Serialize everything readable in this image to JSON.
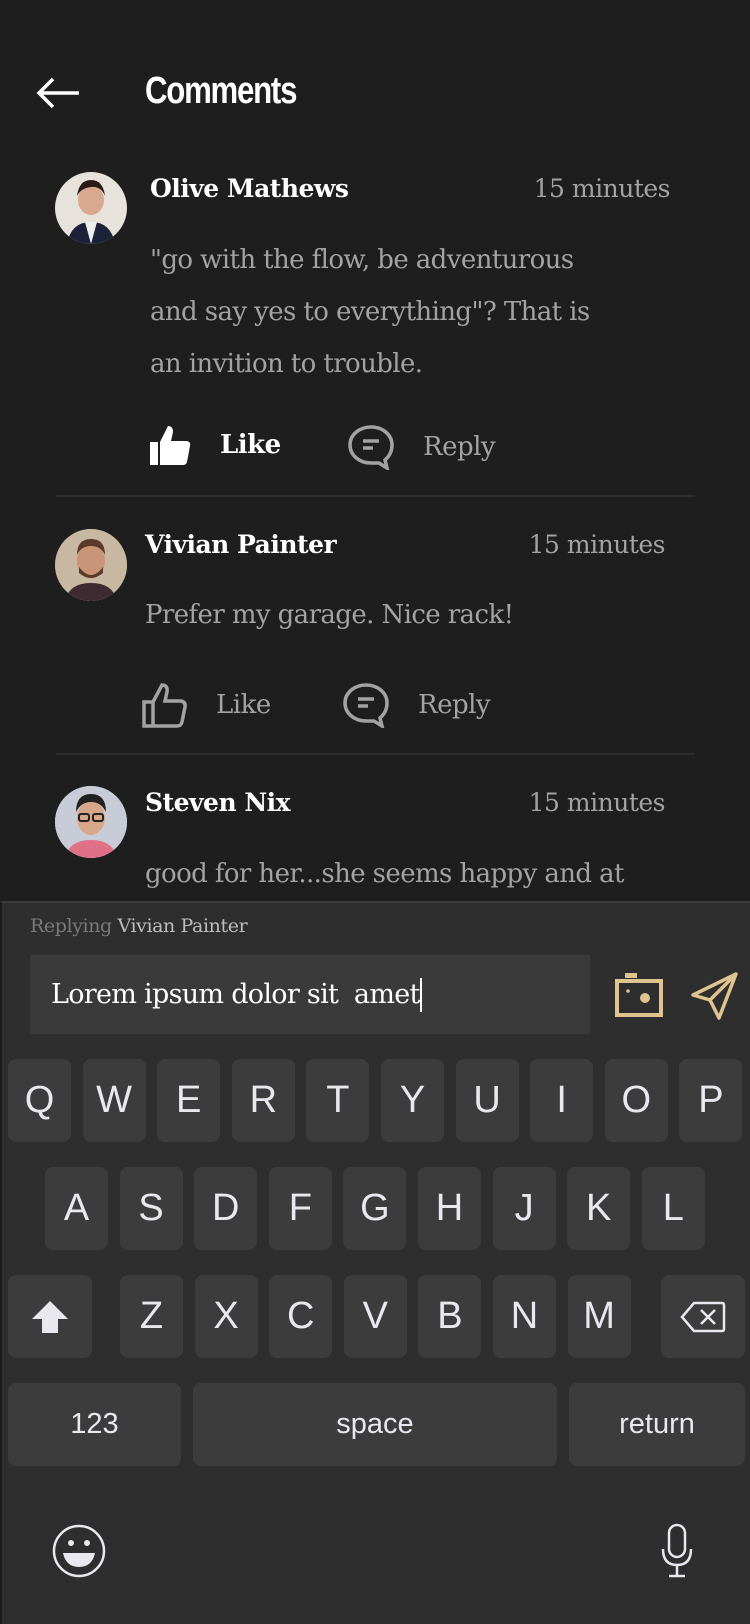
{
  "header": {
    "title": "Comments",
    "back_icon": "arrow-left-icon"
  },
  "comments": [
    {
      "name": "Olive Mathews",
      "time": "15 minutes",
      "lines": [
        "\"go with the flow, be adventurous",
        "and say yes to everything\"?  That is",
        "an invition to trouble."
      ],
      "like": "Like",
      "reply": "Reply",
      "liked": true
    },
    {
      "name": "Vivian Painter",
      "time": "15 minutes",
      "lines": [
        "Prefer my garage. Nice rack!"
      ],
      "like": "Like",
      "reply": "Reply",
      "liked": false
    },
    {
      "name": "Steven Nix",
      "time": "15 minutes",
      "lines": [
        "good for her...she seems happy and at"
      ]
    }
  ],
  "reply_bar": {
    "label": "Replying",
    "target": "Vivian Painter",
    "input_value": "Lorem ipsum dolor sit  amet",
    "accent": "#e0c48f"
  },
  "keyboard": {
    "row1": [
      "Q",
      "W",
      "E",
      "R",
      "T",
      "Y",
      "U",
      "I",
      "O",
      "P"
    ],
    "row2": [
      "A",
      "S",
      "D",
      "F",
      "G",
      "H",
      "J",
      "K",
      "L"
    ],
    "row3": [
      "Z",
      "X",
      "C",
      "V",
      "B",
      "N",
      "M"
    ],
    "numbers": "123",
    "space": "space",
    "return": "return"
  }
}
